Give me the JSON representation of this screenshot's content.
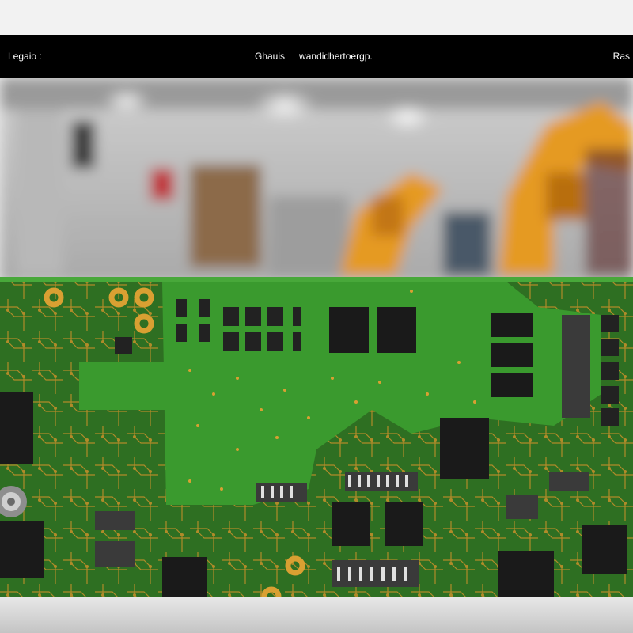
{
  "header": {
    "left_text": "Legaio :",
    "center_left_text": "Ghauis",
    "center_right_text": "wandidhertoergp.",
    "right_text": "Ras"
  },
  "scene": {
    "background": "blurred factory floor with orange robotic arms",
    "subject": "green printed circuit board with black chips and gold traces",
    "colors": {
      "pcb_green": "#3a8f2c",
      "pcb_dark_green": "#2e6f22",
      "trace_gold": "#c8902a",
      "chip_black": "#1a1a1a",
      "robot_orange": "#e59a22",
      "topbar_black": "#000000"
    }
  }
}
